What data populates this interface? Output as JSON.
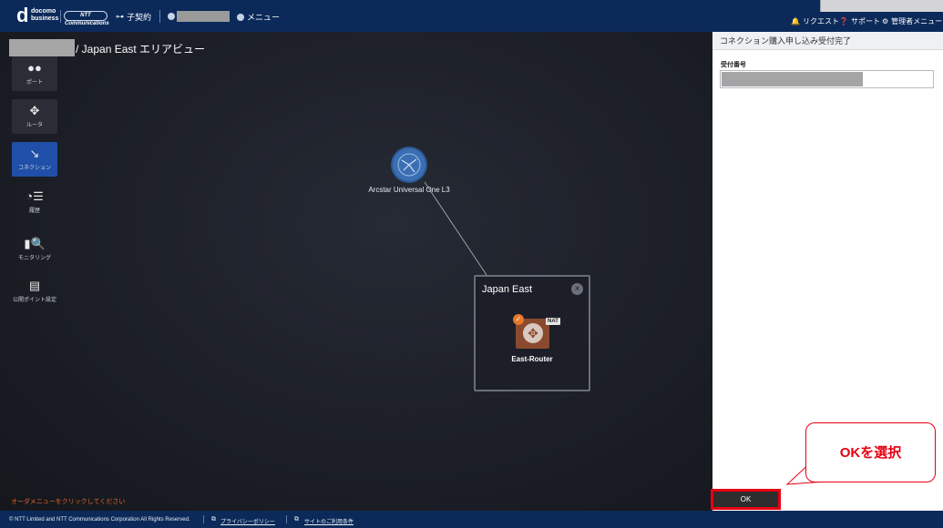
{
  "header": {
    "logo_letter": "d",
    "logo_text_1": "docomo",
    "logo_text_2": "business",
    "ntt_logo_text": "NTT Communications",
    "contract_label": "子契約",
    "menu_label": "メニュー",
    "request_label": "リクエスト",
    "support_label": "サポート",
    "admin_menu_label": "管理者メニュー"
  },
  "breadcrumb": {
    "text": "/ Japan East エリアビュー"
  },
  "sidebar": {
    "items": [
      {
        "label": "ポート",
        "icon": "port-icon",
        "glyph": "●●"
      },
      {
        "label": "ルータ",
        "icon": "router-icon",
        "glyph": "✥"
      },
      {
        "label": "コネクション",
        "icon": "connection-icon",
        "glyph": "↘"
      },
      {
        "label": "履歴",
        "icon": "history-icon",
        "glyph": "◔☰"
      },
      {
        "label": "モニタリング",
        "icon": "monitoring-icon",
        "glyph": "▮🔍"
      },
      {
        "label": "公開ポイント設定",
        "icon": "public-point-icon",
        "glyph": "▤"
      }
    ]
  },
  "canvas": {
    "cloud_node_label": "Arcstar Universal One L3",
    "region_title": "Japan East",
    "router_label": "East-Router",
    "nat_badge": "NAT",
    "hint_text": "オーダメニューをクリックしてください"
  },
  "panel": {
    "title": "コネクション購入申し込み受付完了",
    "reception_number_label": "受付番号",
    "ok_label": "OK"
  },
  "callout": {
    "text": "OKを選択"
  },
  "footer": {
    "copyright": "© NTT Limited and NTT Communications Corporation All Rights Reserved.",
    "privacy_link": "プライバシーポリシー",
    "terms_link": "サイトのご利用条件"
  },
  "colors": {
    "header_bg": "#0b2a5a",
    "active_sidebar": "#1f4fa8",
    "accent_red": "#e60012",
    "hint_orange": "#e0662a",
    "router_brown": "#8a4a2e"
  }
}
